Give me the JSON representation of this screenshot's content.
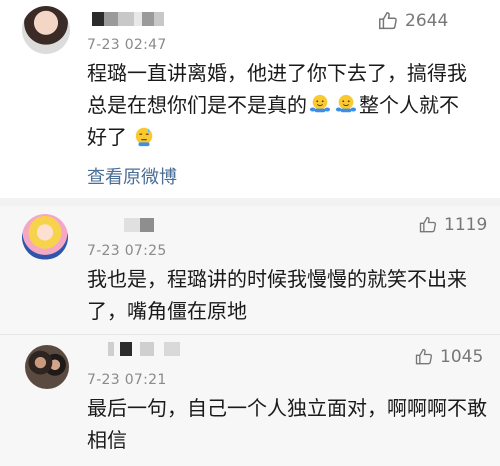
{
  "comments": [
    {
      "time": "7-23 02:47",
      "likes": "2644",
      "text_line1": "程璐一直讲离婚，他进了你下去了，搞得我",
      "text_line2_a": "总是在想你们是不是真的",
      "text_line2_b": "整个人就不",
      "text_line3": "好了",
      "view_original": "查看原微博",
      "icons": [
        "hug-emoji-icon",
        "hug-emoji-icon",
        "sweat-emoji-icon",
        "thumbs-up-icon"
      ]
    },
    {
      "time": "7-23 07:25",
      "likes": "1119",
      "text_line1": "我也是，程璐讲的时候我慢慢的就笑不出来",
      "text_line2": "了，嘴角僵在原地",
      "icons": [
        "thumbs-up-icon"
      ]
    },
    {
      "time": "7-23 07:21",
      "likes": "1045",
      "text_line1": "最后一句，自己一个人独立面对，啊啊啊不敢",
      "text_line2": "相信",
      "icons": [
        "thumbs-up-icon"
      ]
    }
  ],
  "colors": {
    "link": "#4a6e96",
    "meta": "#8a8a8a",
    "separator": "#f2f2f2",
    "highlight_bg": "#f7f7f7"
  }
}
